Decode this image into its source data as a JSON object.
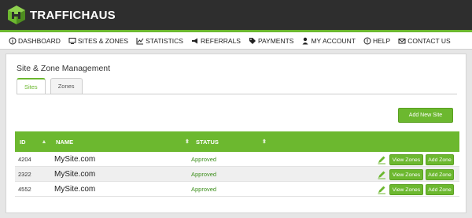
{
  "brand": {
    "name": "TRAFFICHAUS",
    "accent": "#6cb82f",
    "logo_icon": "cube-logo-icon"
  },
  "nav": [
    {
      "label": "DASHBOARD",
      "icon": "info-circle-icon"
    },
    {
      "label": "SITES & ZONES",
      "icon": "monitor-icon"
    },
    {
      "label": "STATISTICS",
      "icon": "chart-icon"
    },
    {
      "label": "REFERRALS",
      "icon": "megaphone-icon"
    },
    {
      "label": "PAYMENTS",
      "icon": "tag-icon"
    },
    {
      "label": "MY ACCOUNT",
      "icon": "user-icon"
    },
    {
      "label": "HELP",
      "icon": "help-circle-icon"
    },
    {
      "label": "CONTACT US",
      "icon": "mail-icon"
    }
  ],
  "panel": {
    "title": "Site & Zone Management"
  },
  "tabs": [
    {
      "label": "Sites",
      "active": true
    },
    {
      "label": "Zones",
      "active": false
    }
  ],
  "actions": {
    "add_new_site": "Add New Site"
  },
  "table": {
    "columns": [
      {
        "label": "ID"
      },
      {
        "label": "NAME"
      },
      {
        "label": "STATUS"
      }
    ],
    "view_zones_label": "View Zones",
    "add_zone_label": "Add Zone",
    "rows": [
      {
        "id": "4204",
        "name": "MySite.com",
        "status": "Approved"
      },
      {
        "id": "2322",
        "name": "MySite.com",
        "status": "Approved"
      },
      {
        "id": "4552",
        "name": "MySite.com",
        "status": "Approved"
      }
    ]
  }
}
